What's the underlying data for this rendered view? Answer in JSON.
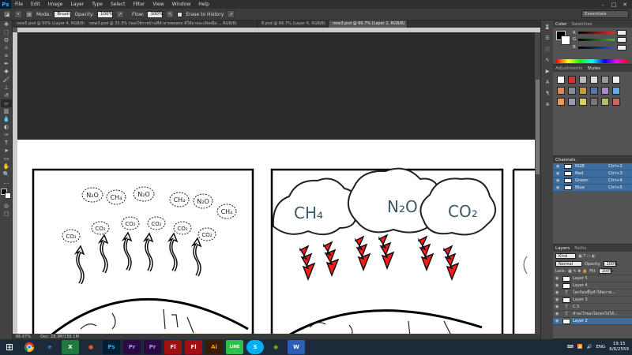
{
  "app": {
    "logo": "Ps"
  },
  "menu": [
    "File",
    "Edit",
    "Image",
    "Layer",
    "Type",
    "Select",
    "Filter",
    "View",
    "Window",
    "Help"
  ],
  "window_controls": {
    "minimize": "–",
    "maximize": "□",
    "close": "✕"
  },
  "options": {
    "mode_label": "Mode:",
    "mode_value": "Brush",
    "opacity_label": "Opacity:",
    "opacity_value": "100%",
    "flow_label": "Flow:",
    "flow_value": "100%",
    "erase_history": "Erase to History"
  },
  "workspace": "Essentials",
  "tabs": [
    {
      "label": "new5.psd @ 50% (Layer 4, RGB/8)",
      "active": false
    },
    {
      "label": "new3.psd @ 33.3% (ของใช้ภายบ้านที่ทำลายทดสอบ ดีใช้ลายละเอียดมือ..., RGB/8)",
      "active": false
    },
    {
      "label": "8.psd @ 66.7% (Layer 6, RGB/8)",
      "active": false
    },
    {
      "label": "new3.psd @ 66.7% (Layer 2, RGB/8)",
      "active": true
    }
  ],
  "status": {
    "zoom": "66.67%",
    "doc": "Doc: 28.3M/156.1M"
  },
  "color_panel": {
    "tabs": [
      "Color",
      "Swatches"
    ],
    "rows": [
      {
        "label": "R",
        "color": "#e03030"
      },
      {
        "label": "G",
        "color": "#30c030"
      },
      {
        "label": "B",
        "color": "#3050e0"
      }
    ]
  },
  "adjustments": {
    "tabs": [
      "Adjustments",
      "Styles"
    ]
  },
  "channels": {
    "tab": "Channels",
    "rows": [
      {
        "name": "RGB",
        "shortcut": "Ctrl+2"
      },
      {
        "name": "Red",
        "shortcut": "Ctrl+3"
      },
      {
        "name": "Green",
        "shortcut": "Ctrl+4"
      },
      {
        "name": "Blue",
        "shortcut": "Ctrl+5"
      }
    ]
  },
  "layers": {
    "tabs": [
      "Layers",
      "Paths"
    ],
    "kind": "Kind",
    "blend": "Normal",
    "opacity_label": "Opacity:",
    "opacity_value": "100%",
    "lock_label": "Lock:",
    "fill_label": "Fill:",
    "fill_value": "100%",
    "rows": [
      {
        "name": "Layer 5",
        "type": "image",
        "selected": false
      },
      {
        "name": "Layer 4",
        "type": "image",
        "selected": false
      },
      {
        "name": "โลกร้อนขึ้นทำให้สภาพ...",
        "type": "text",
        "selected": false
      },
      {
        "name": "Layer 3",
        "type": "image",
        "selected": false
      },
      {
        "name": "C.5",
        "type": "text",
        "selected": false
      },
      {
        "name": "ทำอะไรของโลกอกไปได้...",
        "type": "text",
        "selected": false
      },
      {
        "name": "Layer 2",
        "type": "image",
        "selected": true
      }
    ]
  },
  "comic": {
    "panel1": {
      "clouds": [
        "N₂O",
        "CH₄",
        "N₂O",
        "CH₄",
        "N₂O",
        "CH₄",
        "CO₂",
        "CO₂",
        "CO₂",
        "CO₂",
        "CO₂",
        "CO₂"
      ]
    },
    "panel2": {
      "clouds": [
        "CH₄",
        "N₂O",
        "CO₂"
      ],
      "arrow_color": "#ff1b1b"
    }
  },
  "taskbar": {
    "apps": [
      {
        "label": "e",
        "color": "#2a8ae0"
      },
      {
        "label": "X",
        "color": "#1f7a3e"
      },
      {
        "label": "●",
        "color": "#e05a30"
      },
      {
        "label": "Ps",
        "color": "#31a8ff"
      },
      {
        "label": "Pr",
        "color": "#9999ff"
      },
      {
        "label": "Pr",
        "color": "#9999ff"
      },
      {
        "label": "Fl",
        "color": "#e02020"
      },
      {
        "label": "Fl",
        "color": "#e02020"
      },
      {
        "label": "Ai",
        "color": "#ff9a00"
      },
      {
        "label": "LINE",
        "color": "#2fc04a"
      },
      {
        "label": "S",
        "color": "#00aff0"
      },
      {
        "label": "◉",
        "color": "#80c000"
      },
      {
        "label": "W",
        "color": "#2b5fb5"
      }
    ],
    "lang": "ENG",
    "time": "19:15",
    "date": "6/6/2559"
  }
}
